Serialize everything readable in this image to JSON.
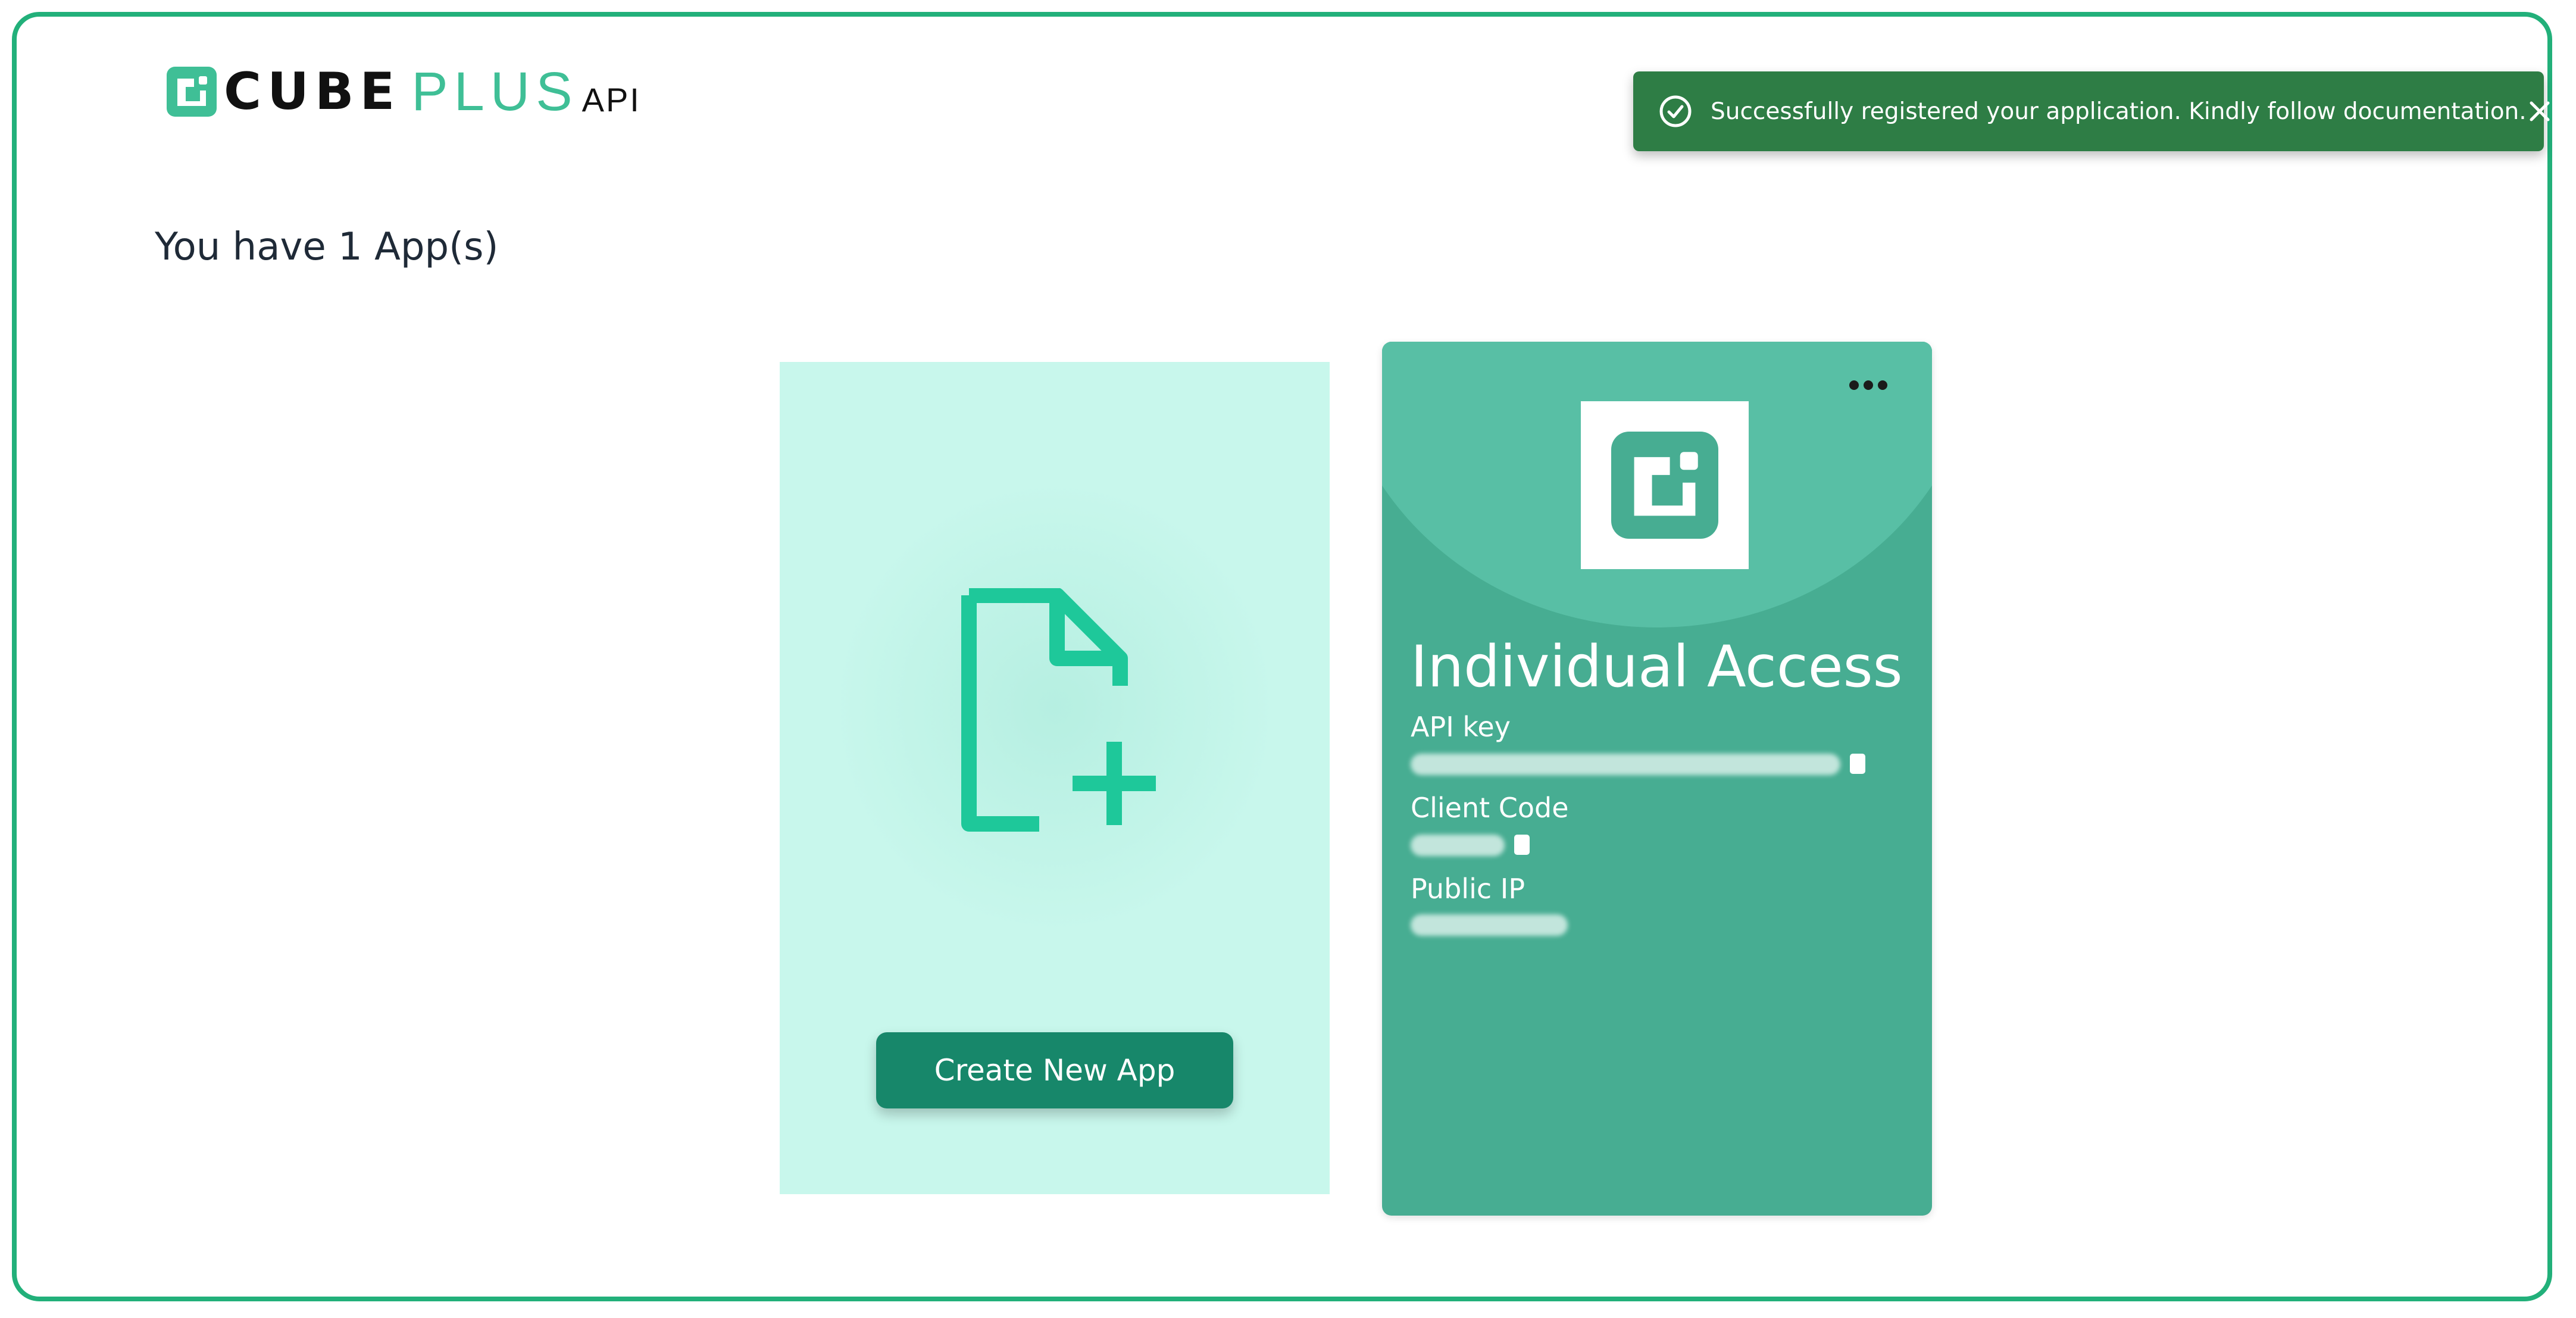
{
  "brand": {
    "cube": "CUBE",
    "plus": "PLUS",
    "api": "API",
    "primary_color": "#22b07a",
    "accent_color": "#3fbf96"
  },
  "page": {
    "title": "You have 1 App(s)"
  },
  "toast": {
    "message": "Successfully registered your application. Kindly follow documentation.",
    "icon": "check-circle-icon",
    "close_icon": "close-icon",
    "background": "#2e7d45"
  },
  "create_card": {
    "icon": "file-add-icon",
    "button_label": "Create New App",
    "background": "#c8f7ec"
  },
  "app_card": {
    "title": "Individual Access",
    "menu_icon": "more-horizontal-icon",
    "fields": [
      {
        "label": "API key",
        "value": "",
        "copy_icon": "copy-icon"
      },
      {
        "label": "Client Code",
        "value": "",
        "copy_icon": "copy-icon"
      },
      {
        "label": "Public IP",
        "value": ""
      }
    ],
    "background": "#47ad92"
  }
}
